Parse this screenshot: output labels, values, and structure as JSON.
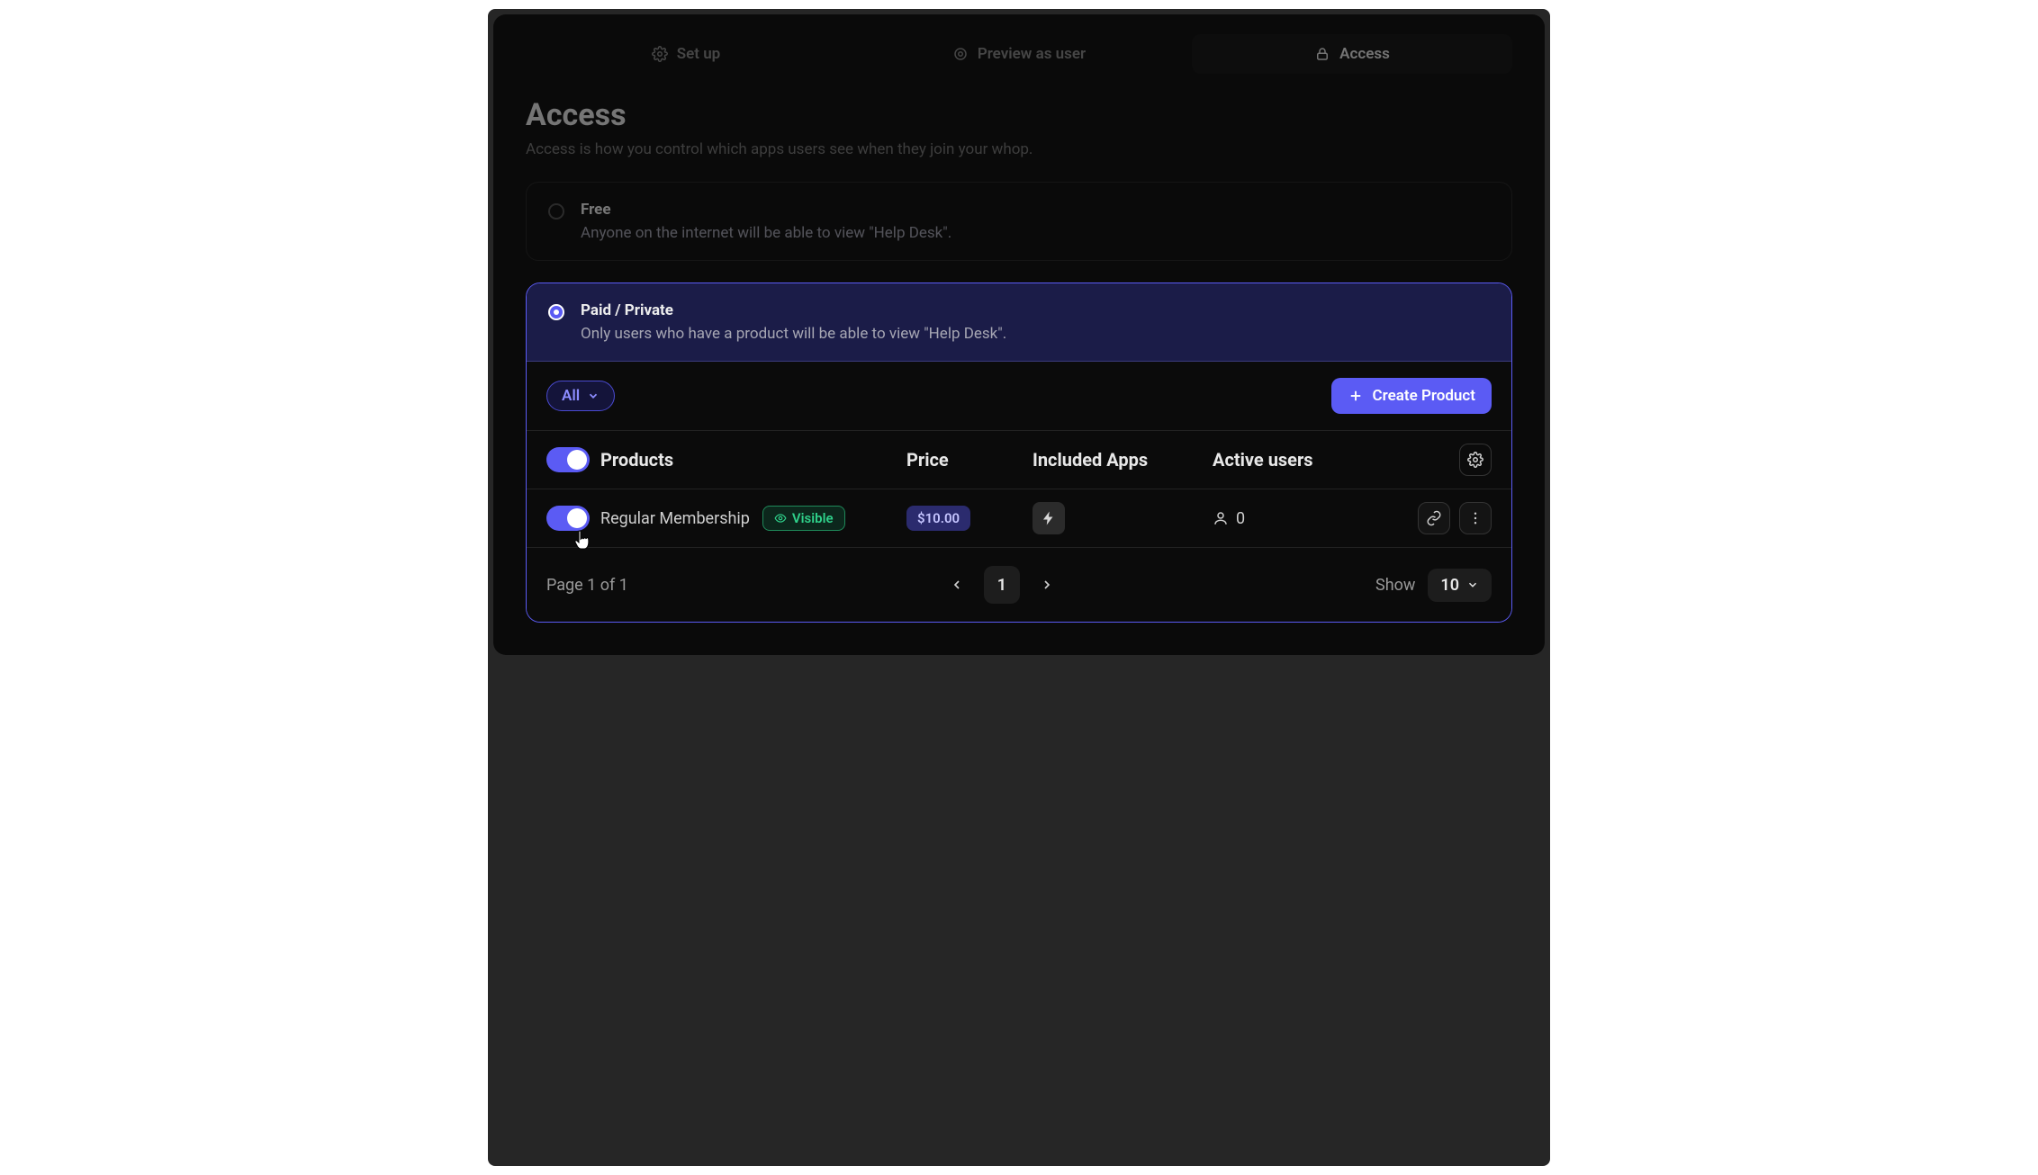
{
  "tabs": {
    "setup": {
      "label": "Set up"
    },
    "preview": {
      "label": "Preview as user"
    },
    "access": {
      "label": "Access"
    }
  },
  "header": {
    "title": "Access",
    "subtitle": "Access is how you control which apps users see when they join your whop."
  },
  "options": {
    "free": {
      "title": "Free",
      "desc": "Anyone on the internet will be able to view \"Help Desk\"."
    },
    "paid": {
      "title": "Paid / Private",
      "desc": "Only users who have a product will be able to view \"Help Desk\"."
    }
  },
  "toolbar": {
    "filter_label": "All",
    "create_label": "Create Product"
  },
  "table": {
    "columns": {
      "products": "Products",
      "price": "Price",
      "apps": "Included Apps",
      "active_users": "Active users"
    },
    "rows": [
      {
        "name": "Regular Membership",
        "visibility": "Visible",
        "price": "$10.00",
        "active_users": "0"
      }
    ]
  },
  "footer": {
    "page_label": "Page 1 of 1",
    "current_page": "1",
    "show_label": "Show",
    "page_size": "10"
  }
}
